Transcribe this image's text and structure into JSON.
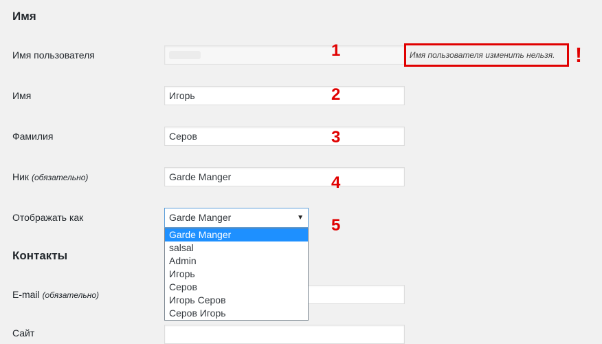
{
  "sections": {
    "name_title": "Имя",
    "contacts_title": "Контакты"
  },
  "rows": {
    "username_label": "Имя пользователя",
    "first_name_label": "Имя",
    "last_name_label": "Фамилия",
    "nickname_label": "Ник",
    "nickname_required": "(обязательно)",
    "display_as_label": "Отображать как",
    "email_label": "E-mail",
    "email_required": "(обязательно)",
    "site_label_partial": "Сайт"
  },
  "fields": {
    "first_name_value": "Игорь",
    "last_name_value": "Серов",
    "nickname_value": "Garde Manger"
  },
  "username_note": "Имя пользователя изменить нельзя.",
  "exclamation": "!",
  "display_select": {
    "selected": "Garde Manger",
    "options": [
      "Garde Manger",
      "salsal",
      "Admin",
      "Игорь",
      "Серов",
      "Игорь Серов",
      "Серов Игорь"
    ]
  },
  "annotations": [
    "1",
    "2",
    "3",
    "4",
    "5"
  ],
  "colors": {
    "annotation_red": "#e00000",
    "selected_option_bg": "#1e90ff",
    "page_bg": "#f1f1f1"
  }
}
